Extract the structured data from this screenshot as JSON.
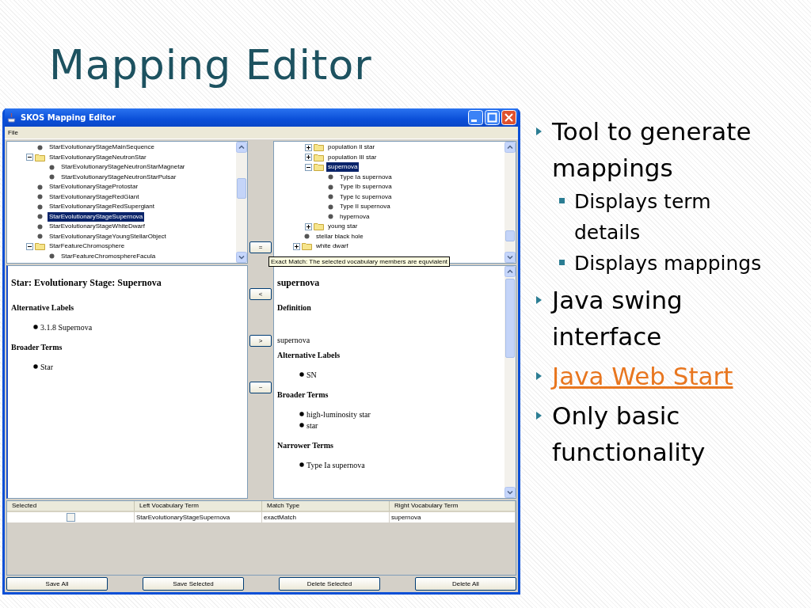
{
  "slide": {
    "title": "Mapping Editor"
  },
  "window": {
    "title": "SKOS Mapping Editor",
    "menu": [
      "File"
    ]
  },
  "left_tree": [
    {
      "label": "StarEvolutionaryStageMainSequence",
      "kind": "leaf",
      "selected": false
    },
    {
      "label": "StarEvolutionaryStageNeutronStar",
      "kind": "folder",
      "expanded": true,
      "selected": false,
      "children": [
        {
          "label": "StarEvolutionaryStageNeutronStarMagnetar",
          "kind": "leaf",
          "selected": false
        },
        {
          "label": "StarEvolutionaryStageNeutronStarPulsar",
          "kind": "leaf",
          "selected": false
        }
      ]
    },
    {
      "label": "StarEvolutionaryStageProtostar",
      "kind": "leaf",
      "selected": false
    },
    {
      "label": "StarEvolutionaryStageRedGiant",
      "kind": "leaf",
      "selected": false
    },
    {
      "label": "StarEvolutionaryStageRedSupergiant",
      "kind": "leaf",
      "selected": false
    },
    {
      "label": "StarEvolutionaryStageSupernova",
      "kind": "leaf",
      "selected": true
    },
    {
      "label": "StarEvolutionaryStageWhiteDwarf",
      "kind": "leaf",
      "selected": false
    },
    {
      "label": "StarEvolutionaryStageYoungStellarObject",
      "kind": "leaf",
      "selected": false
    },
    {
      "label": "StarFeatureChromosphere",
      "kind": "folder",
      "expanded": true,
      "selected": false,
      "children": [
        {
          "label": "StarFeatureChromosphereFacula",
          "kind": "leaf",
          "selected": false
        }
      ]
    }
  ],
  "right_tree": [
    {
      "kind": "group",
      "children": [
        {
          "label": "population II star",
          "kind": "folder",
          "expanded": false,
          "selected": false
        },
        {
          "label": "population III star",
          "kind": "folder",
          "expanded": false,
          "selected": false
        },
        {
          "label": "supernova",
          "kind": "folder",
          "expanded": true,
          "selected": true,
          "children": [
            {
              "label": "Type Ia supernova",
              "kind": "leaf",
              "selected": false
            },
            {
              "label": "Type Ib supernova",
              "kind": "leaf",
              "selected": false
            },
            {
              "label": "Type Ic supernova",
              "kind": "leaf",
              "selected": false
            },
            {
              "label": "Type II supernova",
              "kind": "leaf",
              "selected": false
            },
            {
              "label": "hypernova",
              "kind": "leaf",
              "selected": false
            }
          ]
        },
        {
          "label": "young star",
          "kind": "folder",
          "expanded": false,
          "selected": false
        }
      ]
    },
    {
      "label": "stellar black hole",
      "kind": "leaf",
      "selected": false
    },
    {
      "label": "white dwarf",
      "kind": "folder",
      "expanded": false,
      "selected": false
    }
  ],
  "middle_buttons": [
    "=",
    "<",
    ">",
    "~"
  ],
  "tooltip": "Exact Match: The selected vocabulary members are equvialent",
  "left_details": {
    "title": "Star: Evolutionary Stage: Supernova",
    "sections": [
      {
        "heading": "Alternative Labels",
        "items": [
          "3.1.8 Supernova"
        ]
      },
      {
        "heading": "Broader Terms",
        "items": [
          "Star"
        ]
      }
    ]
  },
  "right_details": {
    "title": "supernova",
    "sections": [
      {
        "heading": "Definition",
        "text": "supernova"
      },
      {
        "heading": "Alternative Labels",
        "items": [
          "SN"
        ]
      },
      {
        "heading": "Broader Terms",
        "items": [
          "high-luminosity star",
          "star"
        ]
      },
      {
        "heading": "Narrower Terms",
        "items": [
          "Type Ia supernova"
        ]
      }
    ]
  },
  "table": {
    "columns": [
      "Selected",
      "Left Vocabulary Term",
      "Match Type",
      "Right Vocabulary Term"
    ],
    "rows": [
      {
        "checked": false,
        "left_term": "StarEvolutionaryStageSupernova",
        "match_type": "exactMatch",
        "right_term": "supernova"
      }
    ]
  },
  "buttons": [
    "Save All",
    "Save Selected",
    "Delete Selected",
    "Delete All"
  ],
  "bullets": [
    {
      "text": "Tool to generate mappings",
      "link": false,
      "children": [
        {
          "text": "Displays term details"
        },
        {
          "text": "Displays mappings"
        }
      ]
    },
    {
      "text": "Java swing interface",
      "link": false
    },
    {
      "text": "Java Web Start",
      "link": true
    },
    {
      "text": "Only basic functionality",
      "link": false
    }
  ]
}
